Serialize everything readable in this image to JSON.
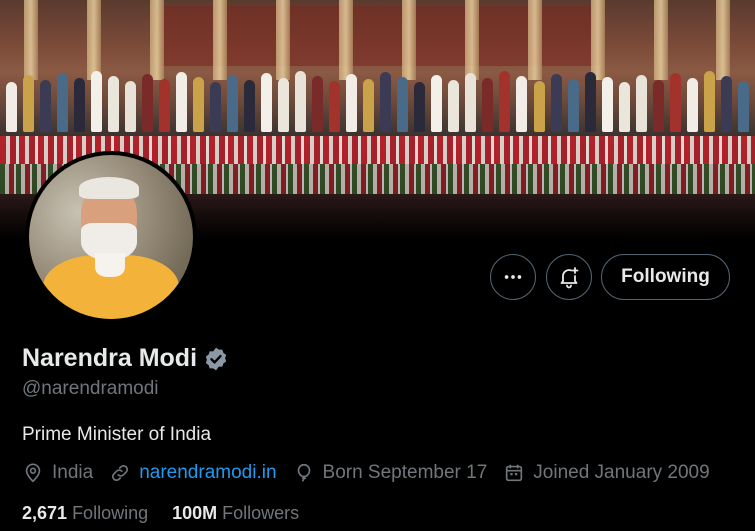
{
  "profile": {
    "name": "Narendra Modi",
    "handle": "@narendramodi",
    "bio": "Prime Minister of India",
    "verified_icon": "verified-badge-icon",
    "verified_color": "#8b98a5"
  },
  "actions": {
    "more_icon": "ellipsis-icon",
    "notify_icon": "bell-plus-icon",
    "follow_label": "Following"
  },
  "meta": {
    "location": "India",
    "website": "narendramodi.in",
    "born": "Born September 17",
    "joined": "Joined January 2009"
  },
  "stats": {
    "following_count": "2,671",
    "following_label": "Following",
    "followers_count": "100M",
    "followers_label": "Followers"
  },
  "colors": {
    "background": "#000000",
    "text_primary": "#e7e9ea",
    "text_secondary": "#71767b",
    "link": "#1d9bf0",
    "border": "#536471"
  }
}
